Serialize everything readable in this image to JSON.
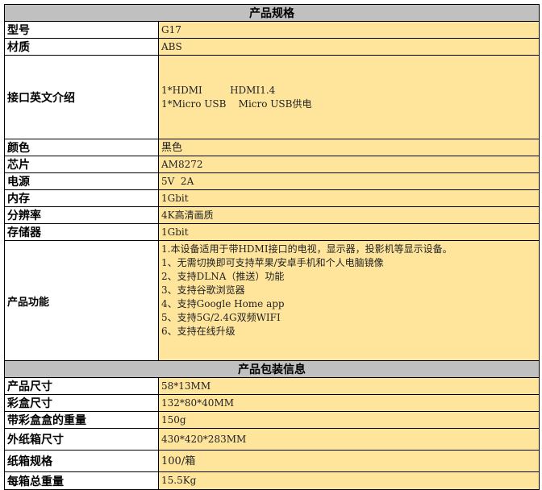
{
  "spec": {
    "title": "产品规格",
    "model": {
      "label": "型号",
      "value": "G17"
    },
    "material": {
      "label": "材质",
      "value": "ABS"
    },
    "interface": {
      "label": "接口英文介绍",
      "lines": [
        "1*HDMI         HDMI1.4",
        "1*Micro USB    Micro USB供电"
      ]
    },
    "color": {
      "label": "颜色",
      "value": "黑色"
    },
    "chip": {
      "label": "芯片",
      "value": "AM8272"
    },
    "power": {
      "label": "电源",
      "value": "5V  2A"
    },
    "memory": {
      "label": "内存",
      "value": "1Gbit"
    },
    "resolution": {
      "label": "分辨率",
      "value": "4K高清画质"
    },
    "storage": {
      "label": "存储器",
      "value": "1Gbit"
    },
    "function": {
      "label": "产品功能",
      "lines": [
        "1.本设备适用于带HDMI接口的电视，显示器，投影机等显示设备。",
        "1、无需切换即可支持苹果/安卓手机和个人电脑镜像",
        "2、支持DLNA（推送）功能",
        "3、支持谷歌浏览器",
        "4、支持Google Home app",
        "5、支持5G/2.4G双频WIFI",
        "6、支持在线升级"
      ]
    }
  },
  "packaging": {
    "title": "产品包装信息",
    "product_size": {
      "label": "产品尺寸",
      "value": "58*13MM"
    },
    "box_size": {
      "label": "彩盒尺寸",
      "value": "132*80*40MM"
    },
    "boxed_weight": {
      "label": "带彩盒盒的重量",
      "value": "150g"
    },
    "carton_size": {
      "label": "外纸箱尺寸",
      "value": "430*420*283MM"
    },
    "carton_spec": {
      "label": "纸箱规格",
      "value": "100/箱"
    },
    "carton_weight": {
      "label": "每箱总重量",
      "value": "15.5Kg"
    }
  }
}
